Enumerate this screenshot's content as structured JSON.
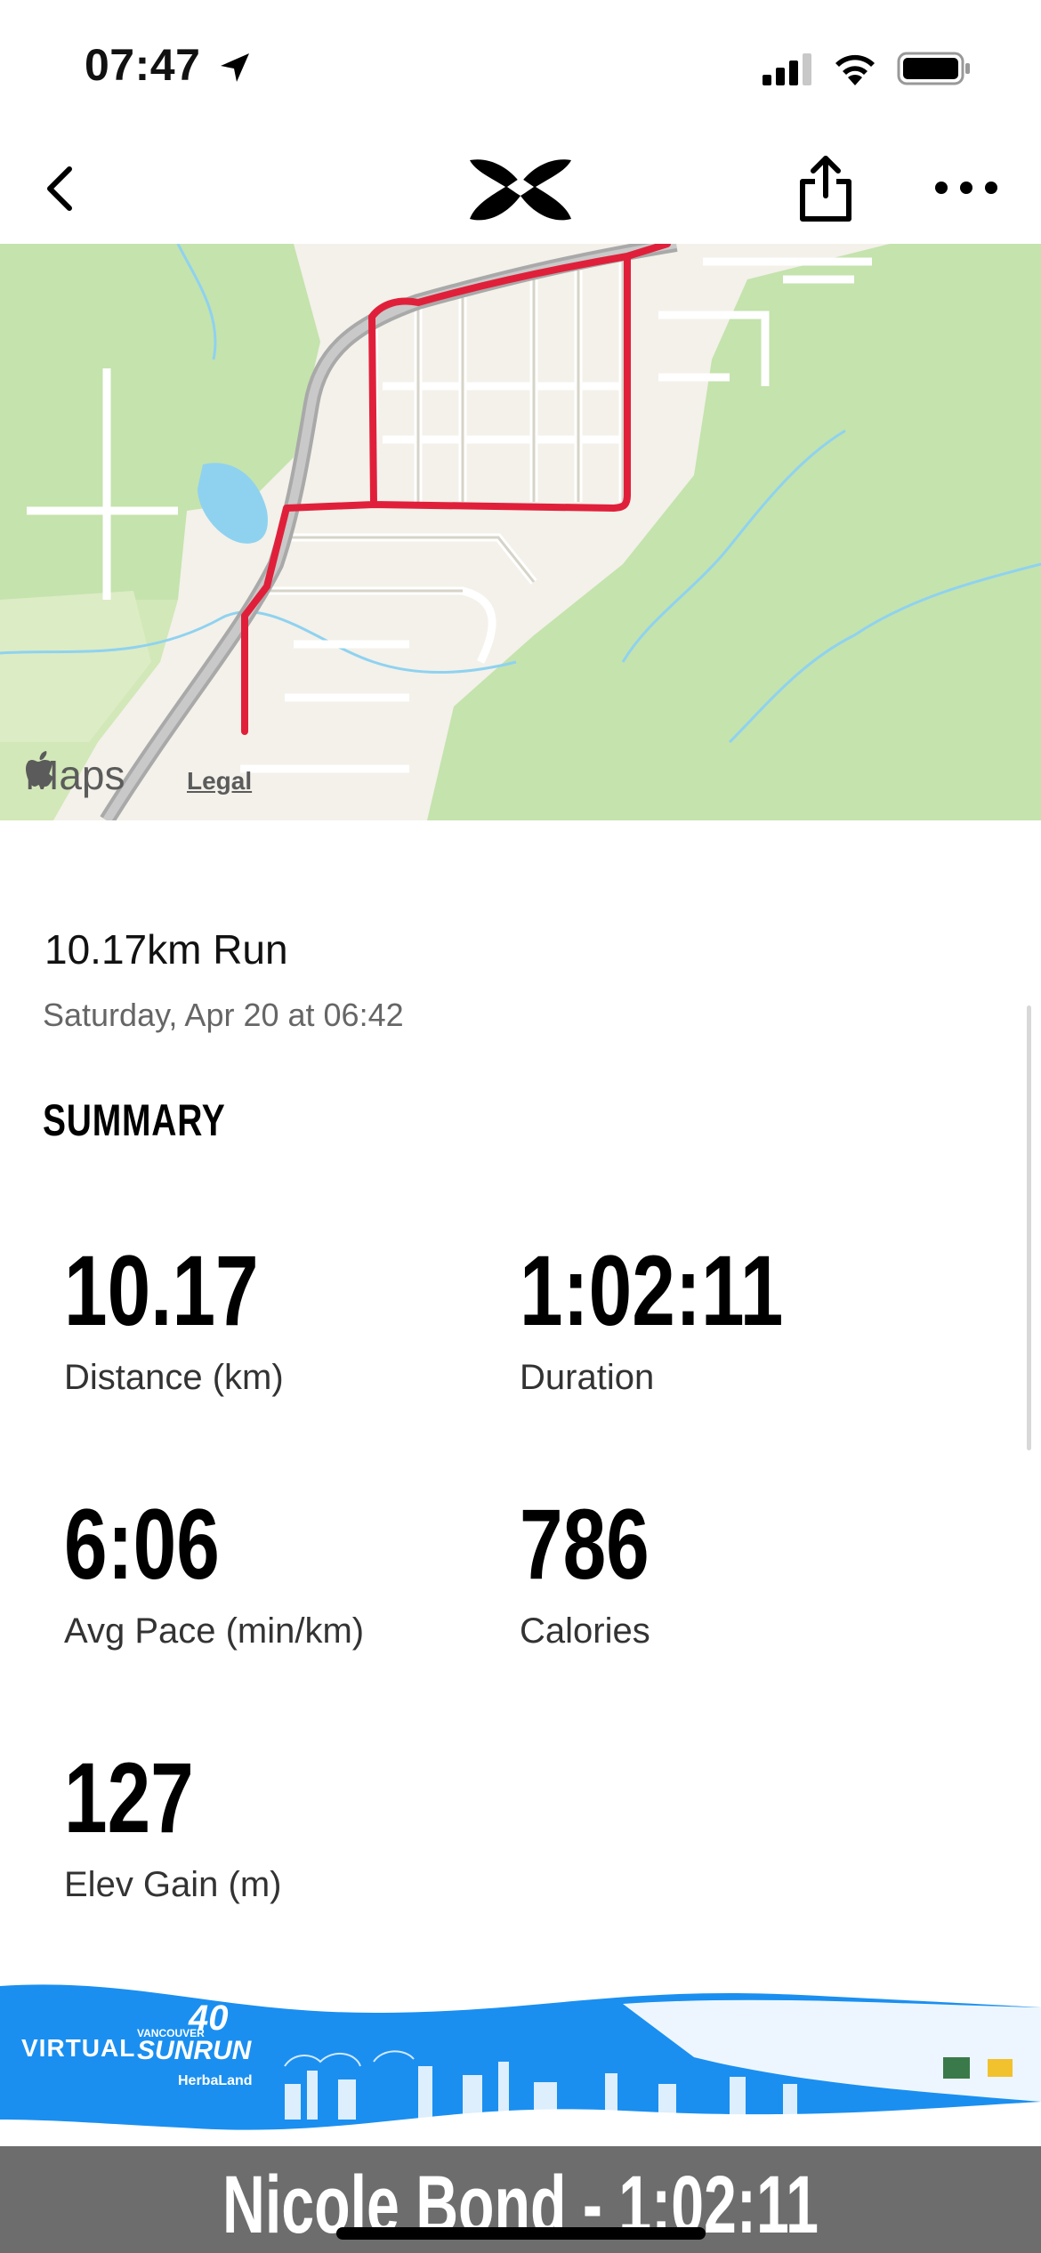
{
  "status_bar": {
    "time": "07:47"
  },
  "map": {
    "brand": "Maps",
    "legal": "Legal"
  },
  "workout": {
    "title": "10.17km Run",
    "date": "Saturday, Apr 20 at 06:42"
  },
  "summary": {
    "heading": "SUMMARY",
    "stats": [
      {
        "value": "10.17",
        "label": "Distance (km)"
      },
      {
        "value": "1:02:11",
        "label": "Duration"
      },
      {
        "value": "6:06",
        "label": "Avg Pace (min/km)"
      },
      {
        "value": "786",
        "label": "Calories"
      },
      {
        "value": "127",
        "label": "Elev Gain (m)"
      }
    ]
  },
  "banner": {
    "virtual": "VIRTUAL",
    "vancouver": "VANCOUVER",
    "sunrun": "SUNRUN",
    "forty": "40",
    "sponsor": "HerbaLand"
  },
  "caption": "Nicole Bond - 1:02:11",
  "colors": {
    "route": "#e0203a",
    "park": "#c5e3ad",
    "water": "#8fd2f0",
    "banner": "#1a8ff0",
    "caption_bar": "#6d6d6d"
  }
}
